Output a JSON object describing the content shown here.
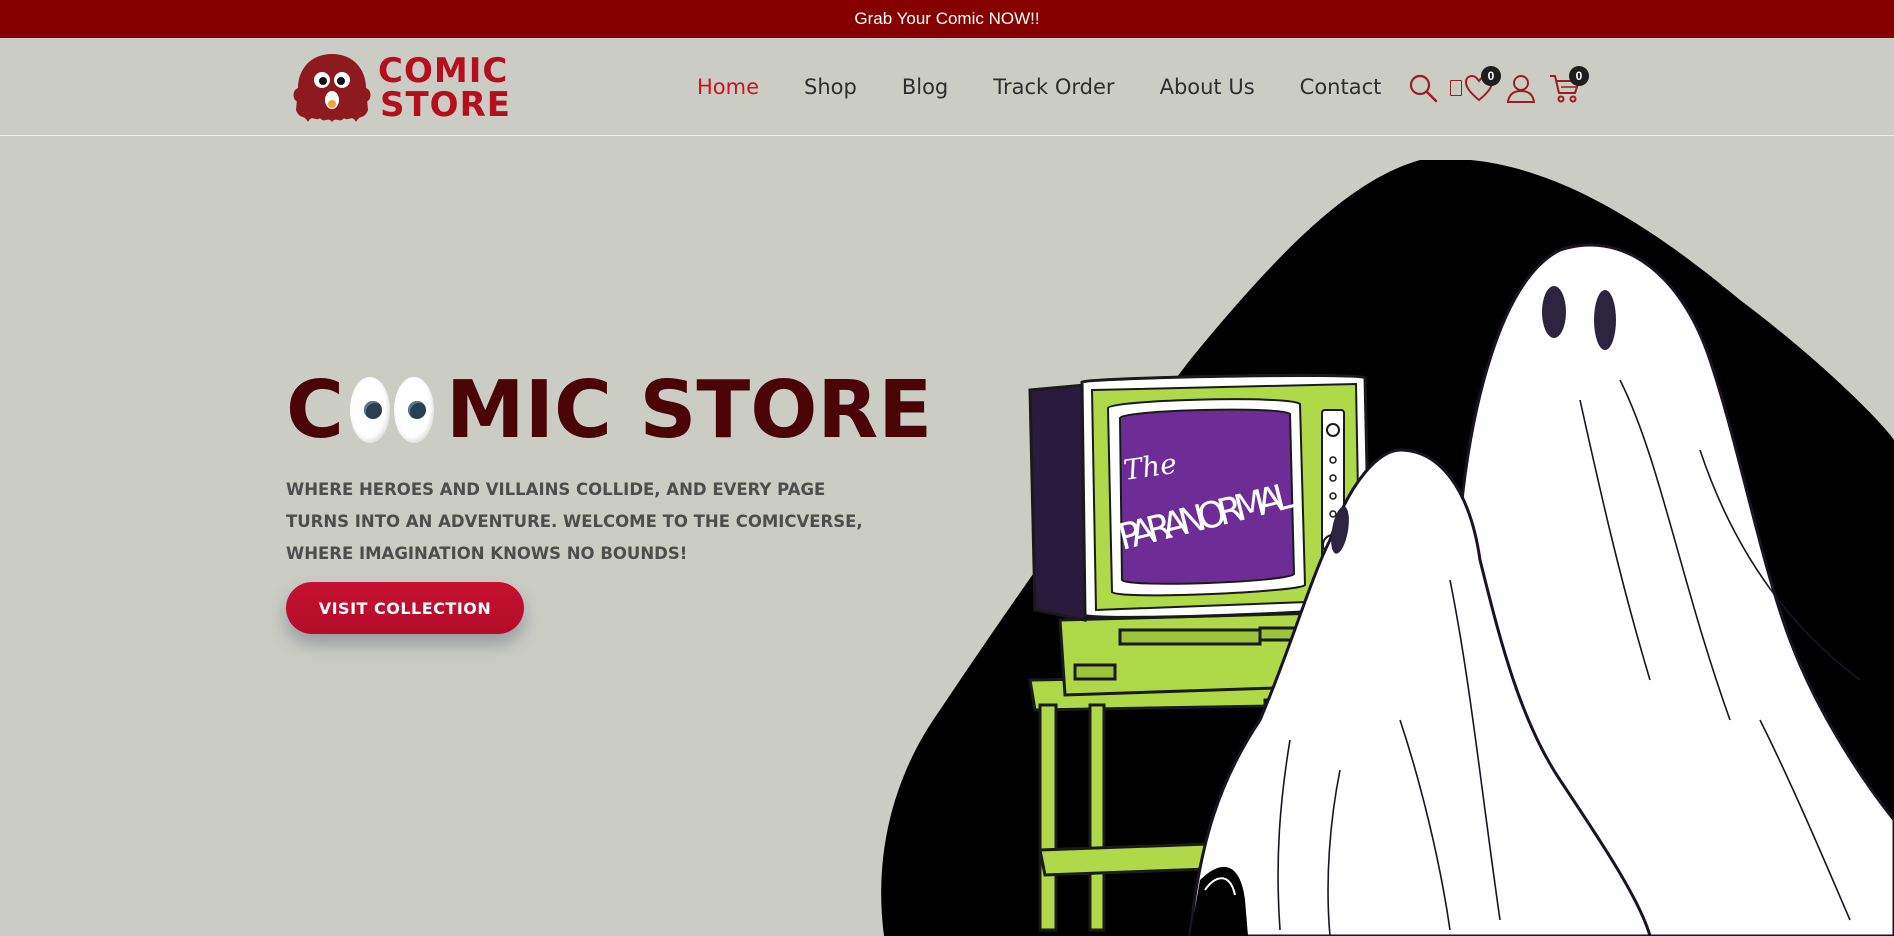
{
  "announcement": {
    "text": "Grab Your Comic NOW!!"
  },
  "logo": {
    "line1": "COMIC",
    "line2": "STORE"
  },
  "nav": {
    "items": [
      {
        "label": "Home",
        "active": true
      },
      {
        "label": "Shop",
        "active": false
      },
      {
        "label": "Blog",
        "active": false
      },
      {
        "label": "Track Order",
        "active": false
      },
      {
        "label": "About Us",
        "active": false
      },
      {
        "label": "Contact",
        "active": false
      }
    ]
  },
  "header_icons": {
    "search": "search-icon",
    "wishlist": "heart-icon",
    "account": "user-icon",
    "cart": "cart-icon",
    "wishlist_count": "0",
    "cart_count": "0"
  },
  "hero": {
    "title_start": "C",
    "title_end": "MIC STORE",
    "subtitle": "WHERE HEROES AND VILLAINS COLLIDE, AND EVERY PAGE TURNS INTO AN ADVENTURE. WELCOME TO THE COMICVERSE, WHERE IMAGINATION KNOWS NO BOUNDS!",
    "cta_label": "VISIT COLLECTION",
    "tv_screen_line1": "The",
    "tv_screen_line2": "PARANORMAL"
  },
  "colors": {
    "accent": "#c8141f",
    "announcement_bg": "#850101",
    "page_bg": "#cbcdc5",
    "title": "#4a0407",
    "tv_green": "#b0d94a",
    "tv_screen": "#6e2d96"
  }
}
